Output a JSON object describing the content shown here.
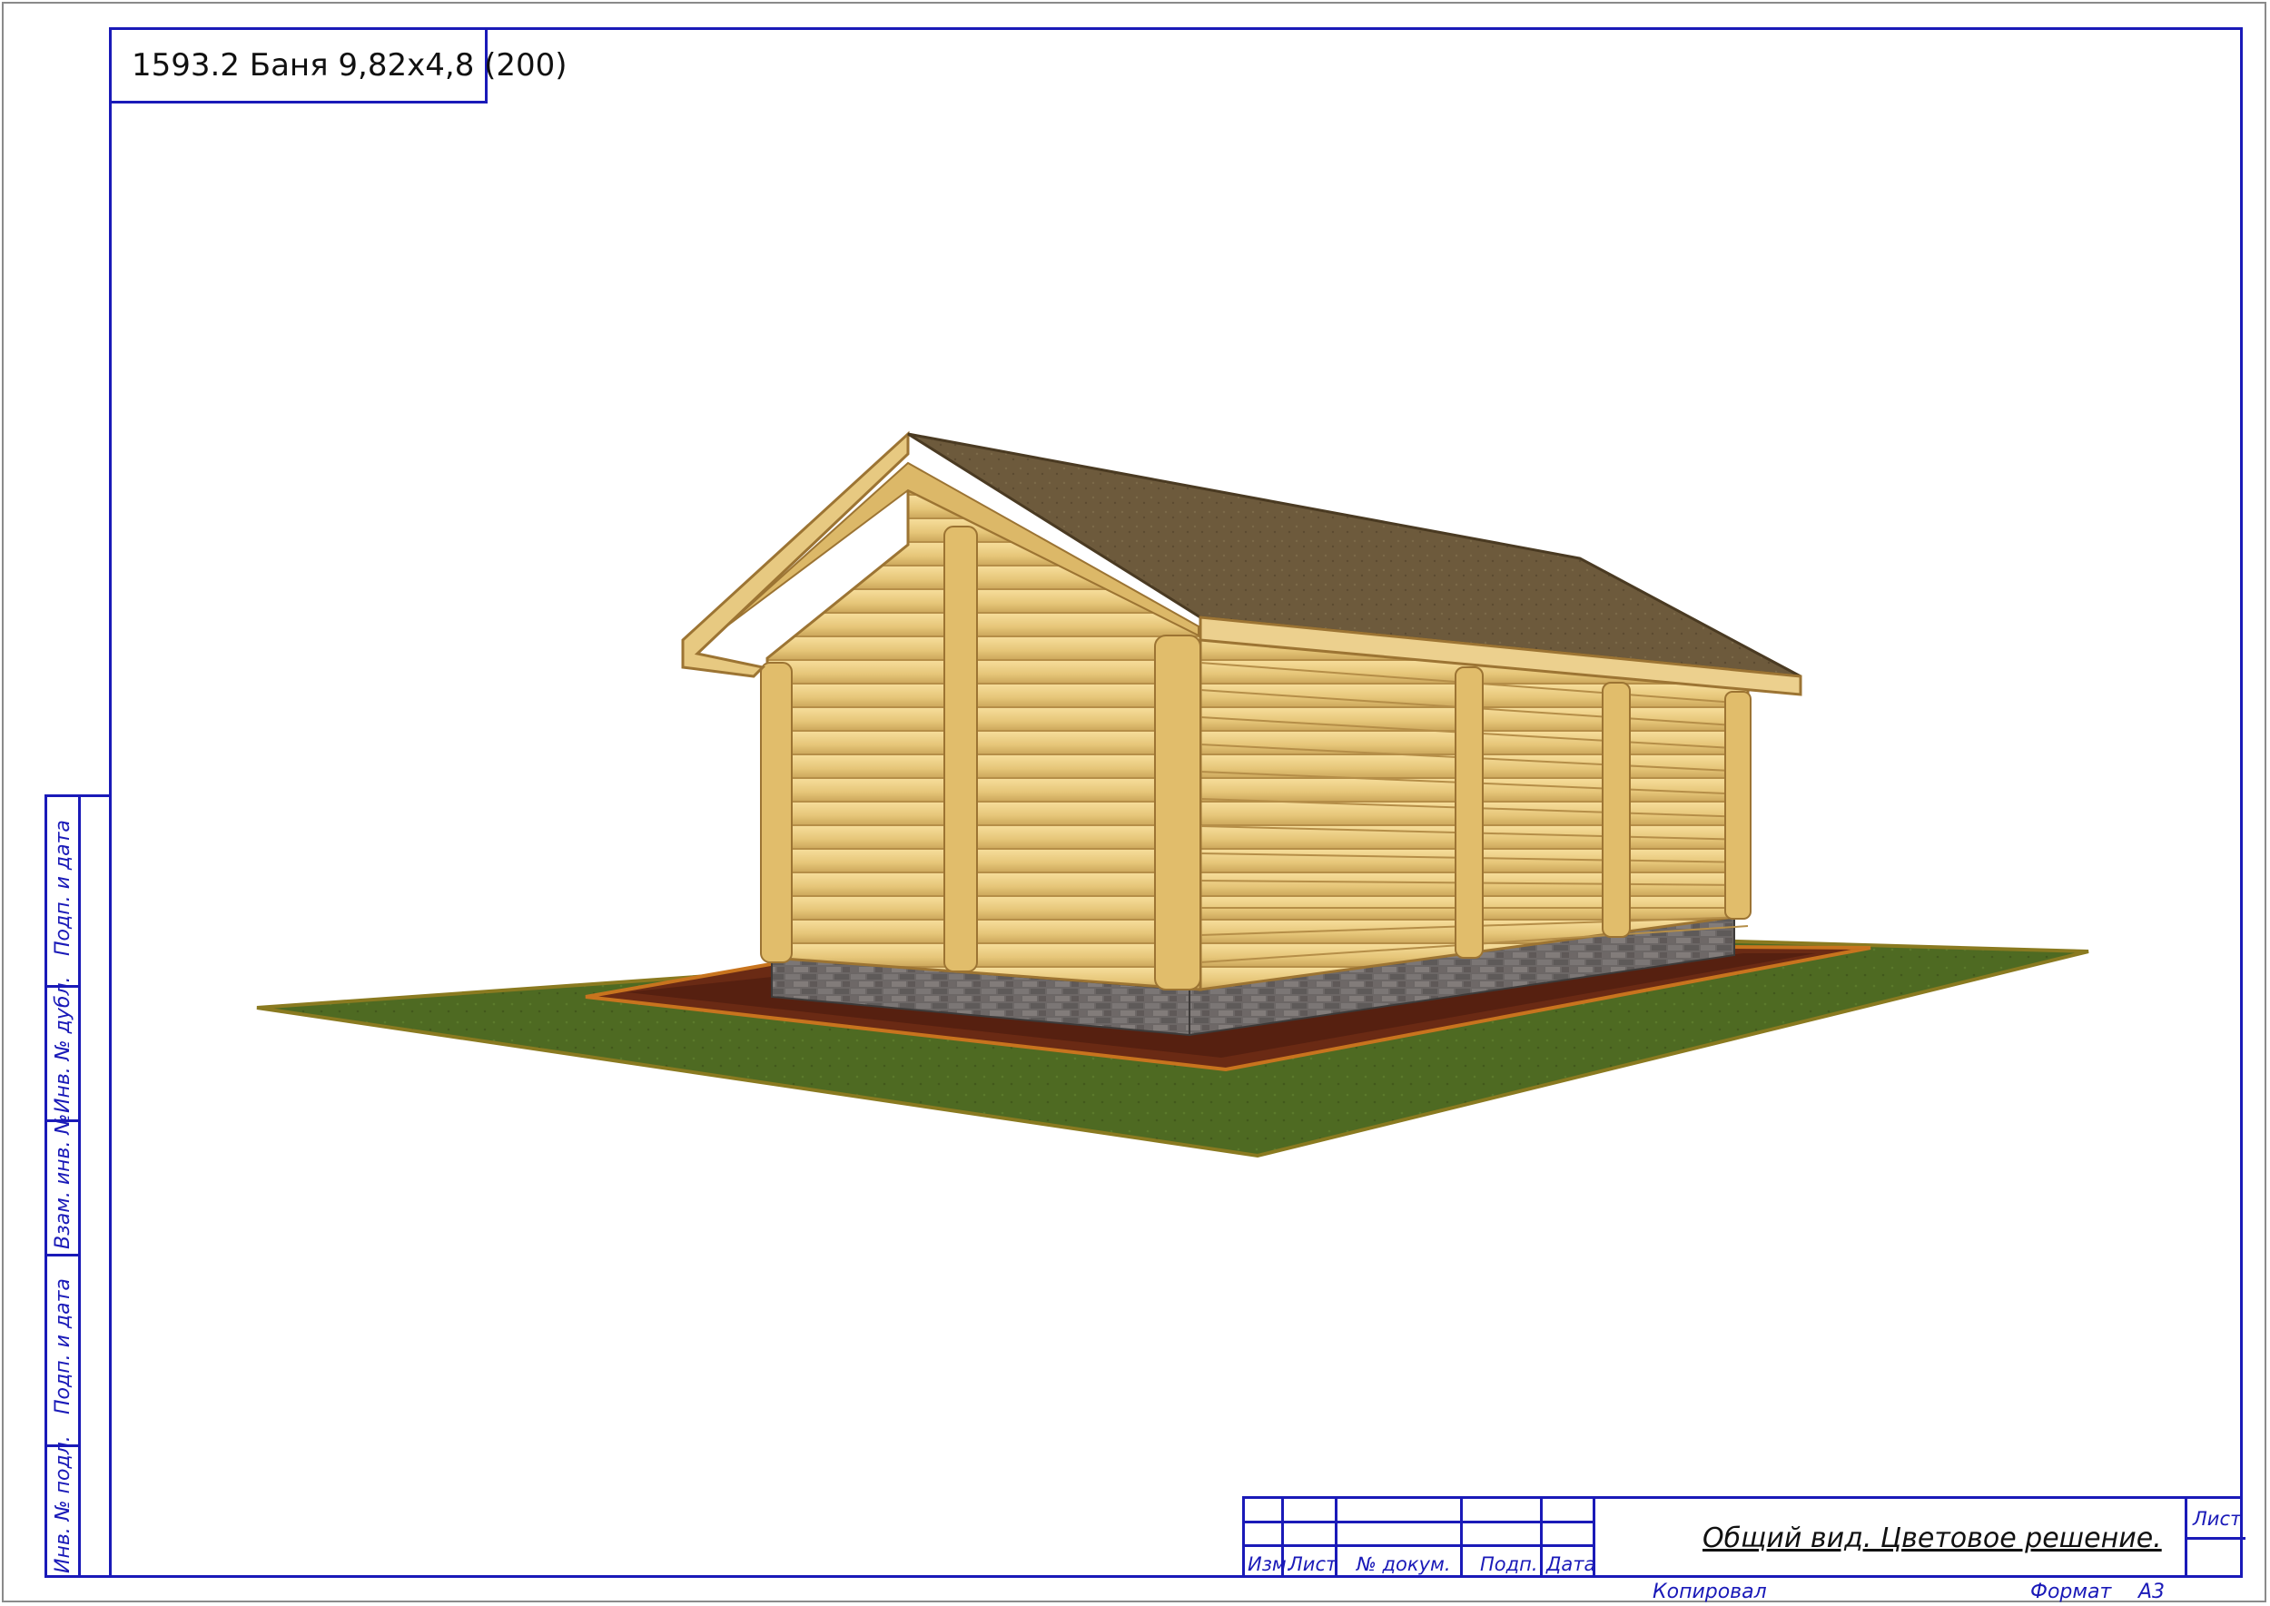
{
  "drawing": {
    "title": "1593.2 Баня 9,82х4,8 (200)",
    "sheet_title": "Общий вид. Цветовое решение."
  },
  "side_labels": {
    "podp_data_top": "Подп. и дата",
    "inv_dubl": "Инв. № дубл.",
    "vzam_inv": "Взам. инв. №",
    "podp_data_bottom": "Подп. и дата",
    "inv_podl": "Инв. № подл."
  },
  "stamp": {
    "izm": "Изм.",
    "list": "Лист",
    "doc_no": "№ докум.",
    "podp": "Подп.",
    "data": "Дата",
    "sheet_label": "Лист"
  },
  "footer": {
    "copied": "Копировал",
    "format_label": "Формат",
    "format_value": "А3"
  },
  "colors": {
    "frame": "#1a1ab8",
    "grass": "#4f6a22",
    "soil": "#6a2a14",
    "logs": "#e8c878",
    "roof": "#6f5a3a",
    "plinth": "#6f6a68"
  }
}
